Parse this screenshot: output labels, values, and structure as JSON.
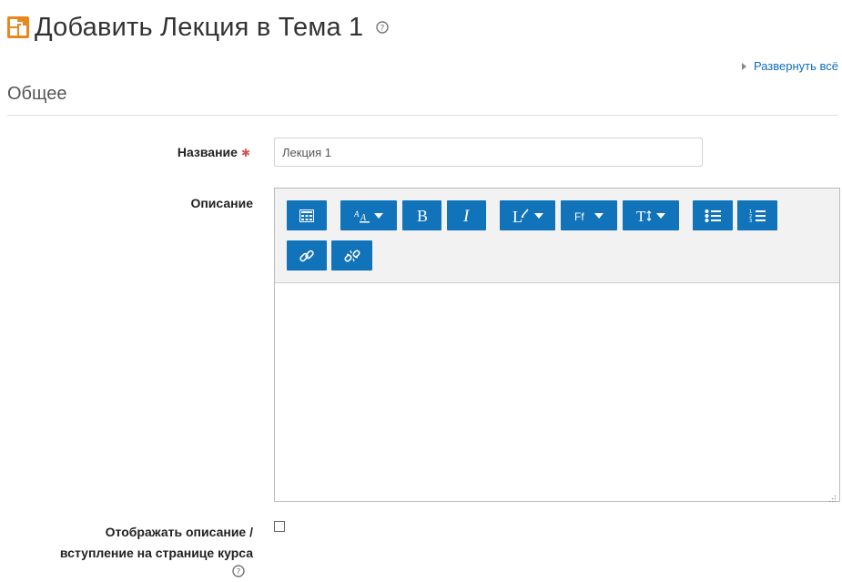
{
  "page": {
    "title": "Добавить Лекция в Тема 1",
    "icon": "lesson-module-icon",
    "help_icon": "help-icon"
  },
  "expand_all": {
    "label": "Развернуть всё",
    "icon": "expand-triangle-icon"
  },
  "section": {
    "legend": "Общее"
  },
  "form": {
    "name": {
      "label": "Название",
      "value": "Лекция 1",
      "required": true
    },
    "description": {
      "label": "Описание",
      "toolbar": [
        {
          "name": "show-more-buttons",
          "icon": "toolbar-toggle-icon"
        },
        {
          "name": "font-color",
          "icon": "font-color-icon",
          "dropdown": true
        },
        {
          "name": "bold",
          "icon": "bold-icon"
        },
        {
          "name": "italic",
          "icon": "italic-icon"
        },
        {
          "name": "paragraph-styles",
          "icon": "paragraph-style-icon",
          "dropdown": true
        },
        {
          "name": "font-family",
          "icon": "font-family-icon",
          "dropdown": true
        },
        {
          "name": "font-size",
          "icon": "font-size-icon",
          "dropdown": true
        },
        {
          "name": "unordered-list",
          "icon": "bullet-list-icon"
        },
        {
          "name": "ordered-list",
          "icon": "numbered-list-icon"
        },
        {
          "name": "link",
          "icon": "link-icon"
        },
        {
          "name": "unlink",
          "icon": "unlink-icon"
        }
      ],
      "content": ""
    },
    "show_description": {
      "label_line1": "Отображать описание /",
      "label_line2": "вступление на странице курса",
      "checked": false
    }
  },
  "colors": {
    "accent": "#1173b9",
    "link": "#0f6cbf",
    "required": "#d9534f"
  }
}
